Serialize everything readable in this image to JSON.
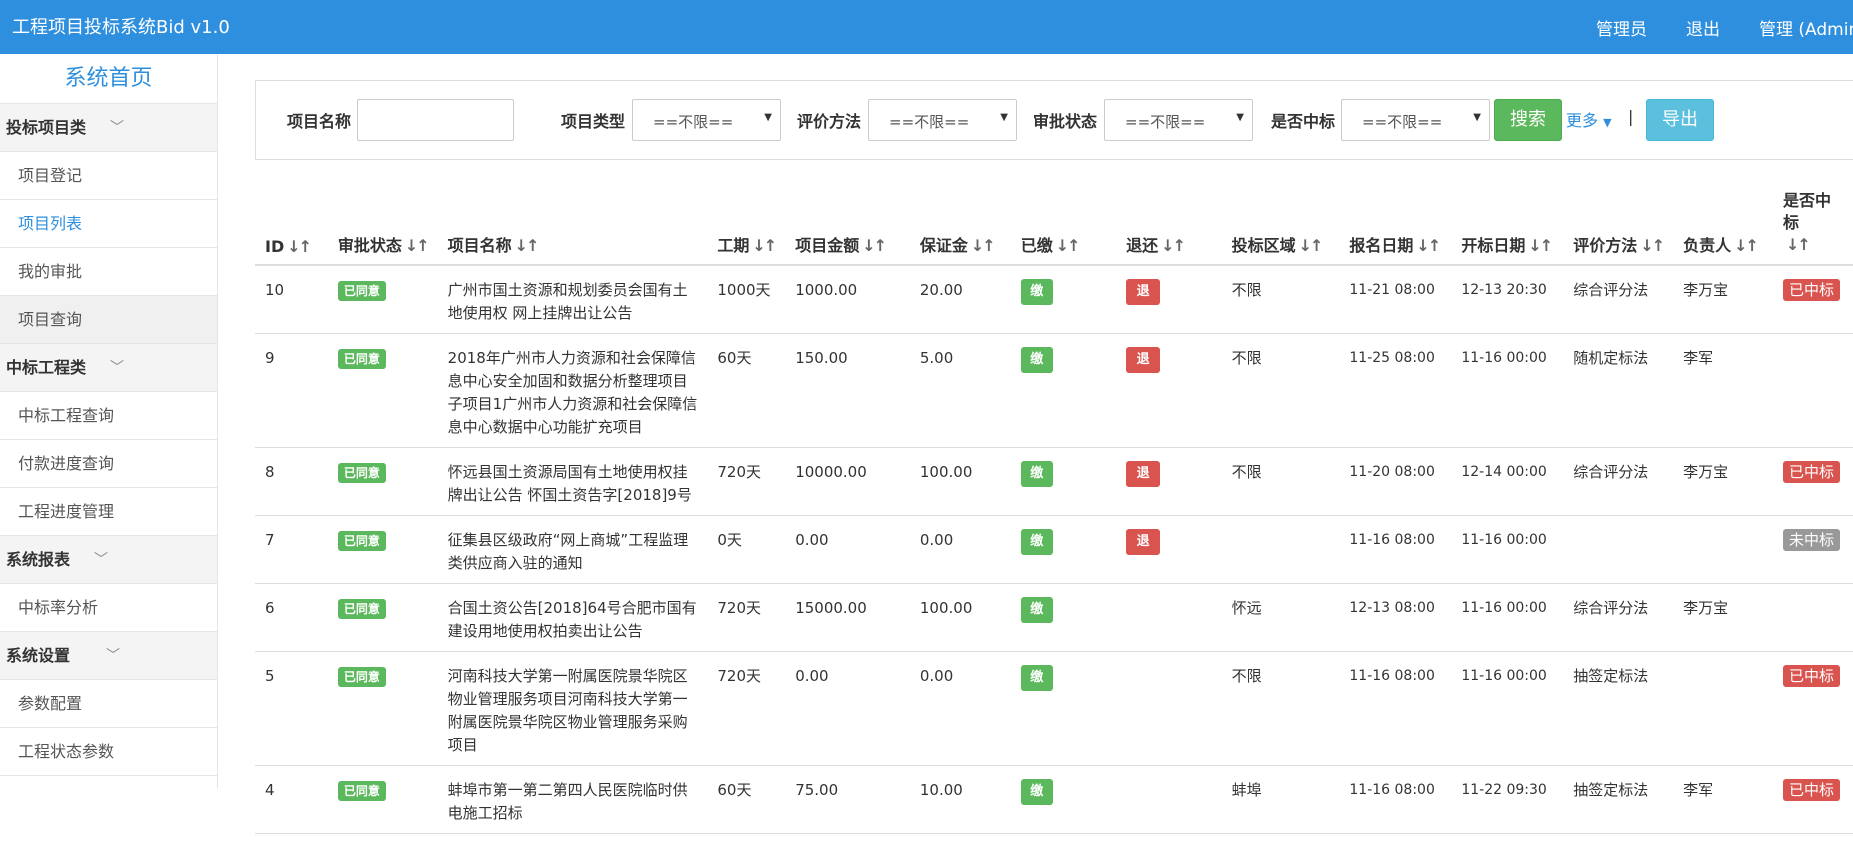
{
  "header": {
    "title": "工程项目投标系统Bid v1.0",
    "nav": [
      "管理员",
      "退出",
      "管理 (Admin"
    ]
  },
  "sidebar": {
    "home": "系统首页",
    "groups": [
      {
        "label": "投标项目类",
        "items": [
          "项目登记",
          "项目列表",
          "我的审批",
          "项目查询"
        ]
      },
      {
        "label": "中标工程类",
        "items": [
          "中标工程查询",
          "付款进度查询",
          "工程进度管理"
        ]
      },
      {
        "label": "系统报表",
        "items": [
          "中标率分析"
        ]
      },
      {
        "label": "系统设置",
        "items": [
          "参数配置",
          "工程状态参数"
        ]
      }
    ]
  },
  "search": {
    "project_name_label": "项目名称",
    "project_name_value": "",
    "project_type_label": "项目类型",
    "project_type_value": "==不限==",
    "eval_method_label": "评价方法",
    "eval_method_value": "==不限==",
    "approval_label": "审批状态",
    "approval_value": "==不限==",
    "win_label": "是否中标",
    "win_value": "==不限==",
    "search_button": "搜索",
    "more_link": "更多",
    "separator": "|",
    "export_button": "导出"
  },
  "table": {
    "sort_icon": "↓↑",
    "columns": [
      "ID",
      "审批状态",
      "项目名称",
      "工期",
      "项目金额",
      "保证金",
      "已缴",
      "退还",
      "投标区域",
      "报名日期",
      "开标日期",
      "评价方法",
      "负责人",
      "是否中标"
    ],
    "rows": [
      {
        "id": "10",
        "status": "已同意",
        "name": "广州市国土资源和规划委员会国有土地使用权 网上挂牌出让公告",
        "period": "1000天",
        "amount": "1000.00",
        "deposit": "20.00",
        "paid": "缴",
        "refund": "退",
        "region": "不限",
        "reg_date": "11-21 08:00",
        "open_date": "12-13 20:30",
        "method": "综合评分法",
        "owner": "李万宝",
        "win": "已中标"
      },
      {
        "id": "9",
        "status": "已同意",
        "name": "2018年广州市人力资源和社会保障信息中心安全加固和数据分析整理项目子项目1广州市人力资源和社会保障信息中心数据中心功能扩充项目",
        "period": "60天",
        "amount": "150.00",
        "deposit": "5.00",
        "paid": "缴",
        "refund": "退",
        "region": "不限",
        "reg_date": "11-25 08:00",
        "open_date": "11-16 00:00",
        "method": "随机定标法",
        "owner": "李军",
        "win": ""
      },
      {
        "id": "8",
        "status": "已同意",
        "name": "怀远县国土资源局国有土地使用权挂牌出让公告 怀国土资告字[2018]9号",
        "period": "720天",
        "amount": "10000.00",
        "deposit": "100.00",
        "paid": "缴",
        "refund": "退",
        "region": "不限",
        "reg_date": "11-20 08:00",
        "open_date": "12-14 00:00",
        "method": "综合评分法",
        "owner": "李万宝",
        "win": "已中标"
      },
      {
        "id": "7",
        "status": "已同意",
        "name": "征集县区级政府“网上商城”工程监理类供应商入驻的通知",
        "period": "0天",
        "amount": "0.00",
        "deposit": "0.00",
        "paid": "缴",
        "refund": "退",
        "region": "",
        "reg_date": "11-16 08:00",
        "open_date": "11-16 00:00",
        "method": "",
        "owner": "",
        "win": "未中标"
      },
      {
        "id": "6",
        "status": "已同意",
        "name": "合国土资公告[2018]64号合肥市国有建设用地使用权拍卖出让公告",
        "period": "720天",
        "amount": "15000.00",
        "deposit": "100.00",
        "paid": "缴",
        "refund": "",
        "region": "怀远",
        "reg_date": "12-13 08:00",
        "open_date": "11-16 00:00",
        "method": "综合评分法",
        "owner": "李万宝",
        "win": ""
      },
      {
        "id": "5",
        "status": "已同意",
        "name": "河南科技大学第一附属医院景华院区物业管理服务项目河南科技大学第一附属医院景华院区物业管理服务采购项目",
        "period": "720天",
        "amount": "0.00",
        "deposit": "0.00",
        "paid": "缴",
        "refund": "",
        "region": "不限",
        "reg_date": "11-16 08:00",
        "open_date": "11-16 00:00",
        "method": "抽签定标法",
        "owner": "",
        "win": "已中标"
      },
      {
        "id": "4",
        "status": "已同意",
        "name": "蚌埠市第一第二第四人民医院临时供电施工招标",
        "period": "60天",
        "amount": "75.00",
        "deposit": "10.00",
        "paid": "缴",
        "refund": "",
        "region": "蚌埠",
        "reg_date": "11-16 08:00",
        "open_date": "11-22 09:30",
        "method": "抽签定标法",
        "owner": "李军",
        "win": "已中标"
      }
    ]
  },
  "colors": {
    "header_bg": "#2d8fde",
    "success": "#5cb85c",
    "danger": "#d9534f",
    "info": "#5bc0de",
    "muted": "#999999"
  }
}
